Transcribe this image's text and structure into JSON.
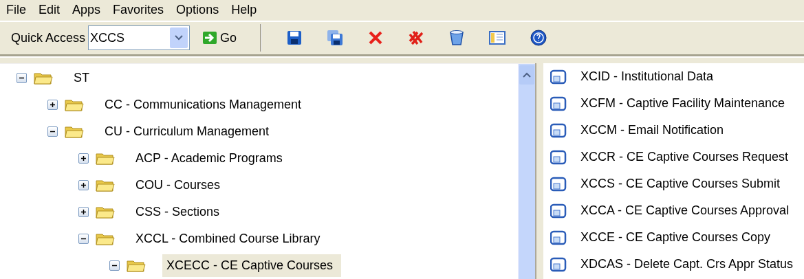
{
  "menu": [
    "File",
    "Edit",
    "Apps",
    "Favorites",
    "Options",
    "Help"
  ],
  "toolbar": {
    "label": "Quick Access",
    "value": "XCCS",
    "go": "Go",
    "tools": [
      {
        "kind": "save"
      },
      {
        "kind": "save-all"
      },
      {
        "kind": "delete"
      },
      {
        "kind": "delete-all"
      },
      {
        "kind": "bucket"
      },
      {
        "kind": "panel"
      },
      {
        "kind": "help"
      }
    ]
  },
  "tree": [
    {
      "label": "ST",
      "expanded": true,
      "selected": false,
      "children": [
        {
          "label": "CC - Communications Management",
          "expanded": false,
          "selected": false
        },
        {
          "label": "CU - Curriculum Management",
          "expanded": true,
          "selected": false,
          "children": [
            {
              "label": "ACP - Academic Programs",
              "expanded": false,
              "selected": false
            },
            {
              "label": "COU - Courses",
              "expanded": false,
              "selected": false
            },
            {
              "label": "CSS - Sections",
              "expanded": false,
              "selected": false
            },
            {
              "label": "XCCL - Combined Course Library",
              "expanded": true,
              "selected": false,
              "children": [
                {
                  "label": "XCECC - CE Captive Courses",
                  "expanded": true,
                  "selected": true
                }
              ]
            }
          ]
        }
      ]
    }
  ],
  "forms": [
    "XCID - Institutional Data",
    "XCFM - Captive Facility Maintenance",
    "XCCM - Email Notification",
    "XCCR - CE Captive Courses Request",
    "XCCS - CE Captive Courses Submit",
    "XCCA - CE Captive Courses Approval",
    "XCCE - CE Captive Courses Copy",
    "XDCAS - Delete Capt. Crs Appr Status"
  ]
}
